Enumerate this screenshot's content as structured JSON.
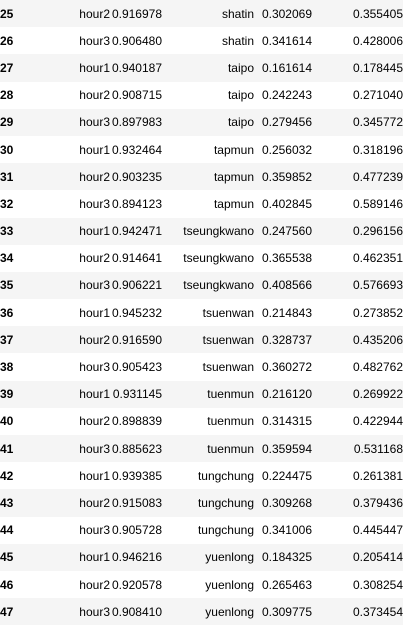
{
  "rows": [
    {
      "index": "25",
      "hour": "hour2",
      "score": "0.916978",
      "station": "shatin",
      "val_a": "0.302069",
      "val_b": "0.355405"
    },
    {
      "index": "26",
      "hour": "hour3",
      "score": "0.906480",
      "station": "shatin",
      "val_a": "0.341614",
      "val_b": "0.428006"
    },
    {
      "index": "27",
      "hour": "hour1",
      "score": "0.940187",
      "station": "taipo",
      "val_a": "0.161614",
      "val_b": "0.178445"
    },
    {
      "index": "28",
      "hour": "hour2",
      "score": "0.908715",
      "station": "taipo",
      "val_a": "0.242243",
      "val_b": "0.271040"
    },
    {
      "index": "29",
      "hour": "hour3",
      "score": "0.897983",
      "station": "taipo",
      "val_a": "0.279456",
      "val_b": "0.345772"
    },
    {
      "index": "30",
      "hour": "hour1",
      "score": "0.932464",
      "station": "tapmun",
      "val_a": "0.256032",
      "val_b": "0.318196"
    },
    {
      "index": "31",
      "hour": "hour2",
      "score": "0.903235",
      "station": "tapmun",
      "val_a": "0.359852",
      "val_b": "0.477239"
    },
    {
      "index": "32",
      "hour": "hour3",
      "score": "0.894123",
      "station": "tapmun",
      "val_a": "0.402845",
      "val_b": "0.589146"
    },
    {
      "index": "33",
      "hour": "hour1",
      "score": "0.942471",
      "station": "tseungkwano",
      "val_a": "0.247560",
      "val_b": "0.296156"
    },
    {
      "index": "34",
      "hour": "hour2",
      "score": "0.914641",
      "station": "tseungkwano",
      "val_a": "0.365538",
      "val_b": "0.462351"
    },
    {
      "index": "35",
      "hour": "hour3",
      "score": "0.906221",
      "station": "tseungkwano",
      "val_a": "0.408566",
      "val_b": "0.576693"
    },
    {
      "index": "36",
      "hour": "hour1",
      "score": "0.945232",
      "station": "tsuenwan",
      "val_a": "0.214843",
      "val_b": "0.273852"
    },
    {
      "index": "37",
      "hour": "hour2",
      "score": "0.916590",
      "station": "tsuenwan",
      "val_a": "0.328737",
      "val_b": "0.435206"
    },
    {
      "index": "38",
      "hour": "hour3",
      "score": "0.905423",
      "station": "tsuenwan",
      "val_a": "0.360272",
      "val_b": "0.482762"
    },
    {
      "index": "39",
      "hour": "hour1",
      "score": "0.931145",
      "station": "tuenmun",
      "val_a": "0.216120",
      "val_b": "0.269922"
    },
    {
      "index": "40",
      "hour": "hour2",
      "score": "0.898839",
      "station": "tuenmun",
      "val_a": "0.314315",
      "val_b": "0.422944"
    },
    {
      "index": "41",
      "hour": "hour3",
      "score": "0.885623",
      "station": "tuenmun",
      "val_a": "0.359594",
      "val_b": "0.531168"
    },
    {
      "index": "42",
      "hour": "hour1",
      "score": "0.939385",
      "station": "tungchung",
      "val_a": "0.224475",
      "val_b": "0.261381"
    },
    {
      "index": "43",
      "hour": "hour2",
      "score": "0.915083",
      "station": "tungchung",
      "val_a": "0.309268",
      "val_b": "0.379436"
    },
    {
      "index": "44",
      "hour": "hour3",
      "score": "0.905728",
      "station": "tungchung",
      "val_a": "0.341006",
      "val_b": "0.445447"
    },
    {
      "index": "45",
      "hour": "hour1",
      "score": "0.946216",
      "station": "yuenlong",
      "val_a": "0.184325",
      "val_b": "0.205414"
    },
    {
      "index": "46",
      "hour": "hour2",
      "score": "0.920578",
      "station": "yuenlong",
      "val_a": "0.265463",
      "val_b": "0.308254"
    },
    {
      "index": "47",
      "hour": "hour3",
      "score": "0.908410",
      "station": "yuenlong",
      "val_a": "0.309775",
      "val_b": "0.373454"
    }
  ]
}
